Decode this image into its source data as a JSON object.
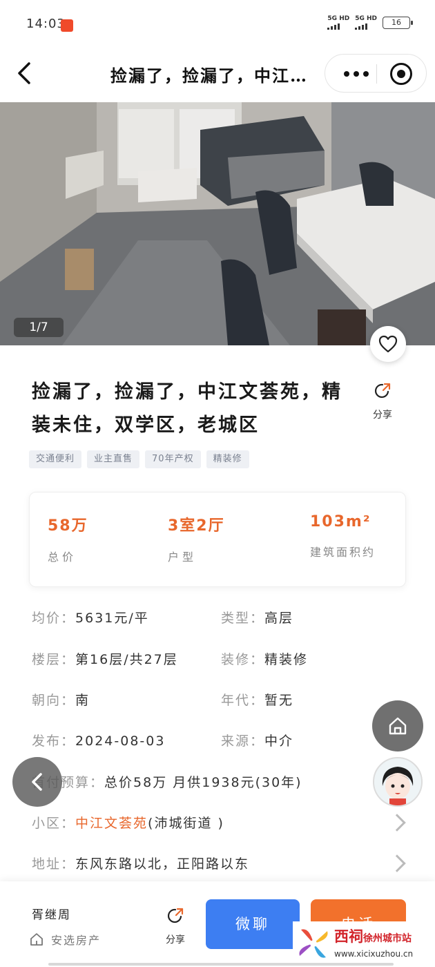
{
  "status_bar": {
    "time": "14:03",
    "network_1": "5G HD",
    "network_2": "5G HD",
    "battery": "16"
  },
  "nav": {
    "title": "捡漏了，捡漏了，中江…"
  },
  "gallery": {
    "counter": "1/7"
  },
  "listing": {
    "title_line1": "捡漏了，捡漏了，中江文荟苑，精",
    "title_line2": "装未住，双学区，老城区",
    "share_label": "分享",
    "tags": [
      "交通便利",
      "业主直售",
      "70年产权",
      "精装修"
    ]
  },
  "stats": {
    "price_value": "58万",
    "price_label": "总价",
    "layout_value": "3室2厅",
    "layout_label": "户型",
    "area_value": "103m²",
    "area_label": "建筑面积约"
  },
  "details": {
    "unit_price_key": "均价：",
    "unit_price_val": "5631元/平",
    "type_key": "类型：",
    "type_val": "高层",
    "floor_key": "楼层：",
    "floor_val": "第16层/共27层",
    "decor_key": "装修：",
    "decor_val": "精装修",
    "orient_key": "朝向：",
    "orient_val": "南",
    "year_key": "年代：",
    "year_val": "暂无",
    "publish_key": "发布：",
    "publish_val": "2024-08-03",
    "source_key": "来源：",
    "source_val": "中介",
    "budget_key": "首付预算：",
    "budget_val": "总价58万  月供1938元(30年)",
    "community_key": "小区：",
    "community_name": "中江文荟苑",
    "community_sub": "(沛城街道 )",
    "address_key": "地址：",
    "address_val": "东风东路以北，正阳路以东"
  },
  "bottom_bar": {
    "agent_name": "胥继周",
    "agency": "安选房产",
    "share_label": "分享",
    "chat_label": "微聊",
    "phone_label": "电话"
  },
  "watermark": {
    "brand": "西祠",
    "city": "徐州城市站",
    "url": "www.xicixuzhou.cn"
  },
  "colors": {
    "accent_orange": "#e8672c",
    "chat_blue": "#3d7ef2",
    "phone_orange": "#f2712c"
  }
}
